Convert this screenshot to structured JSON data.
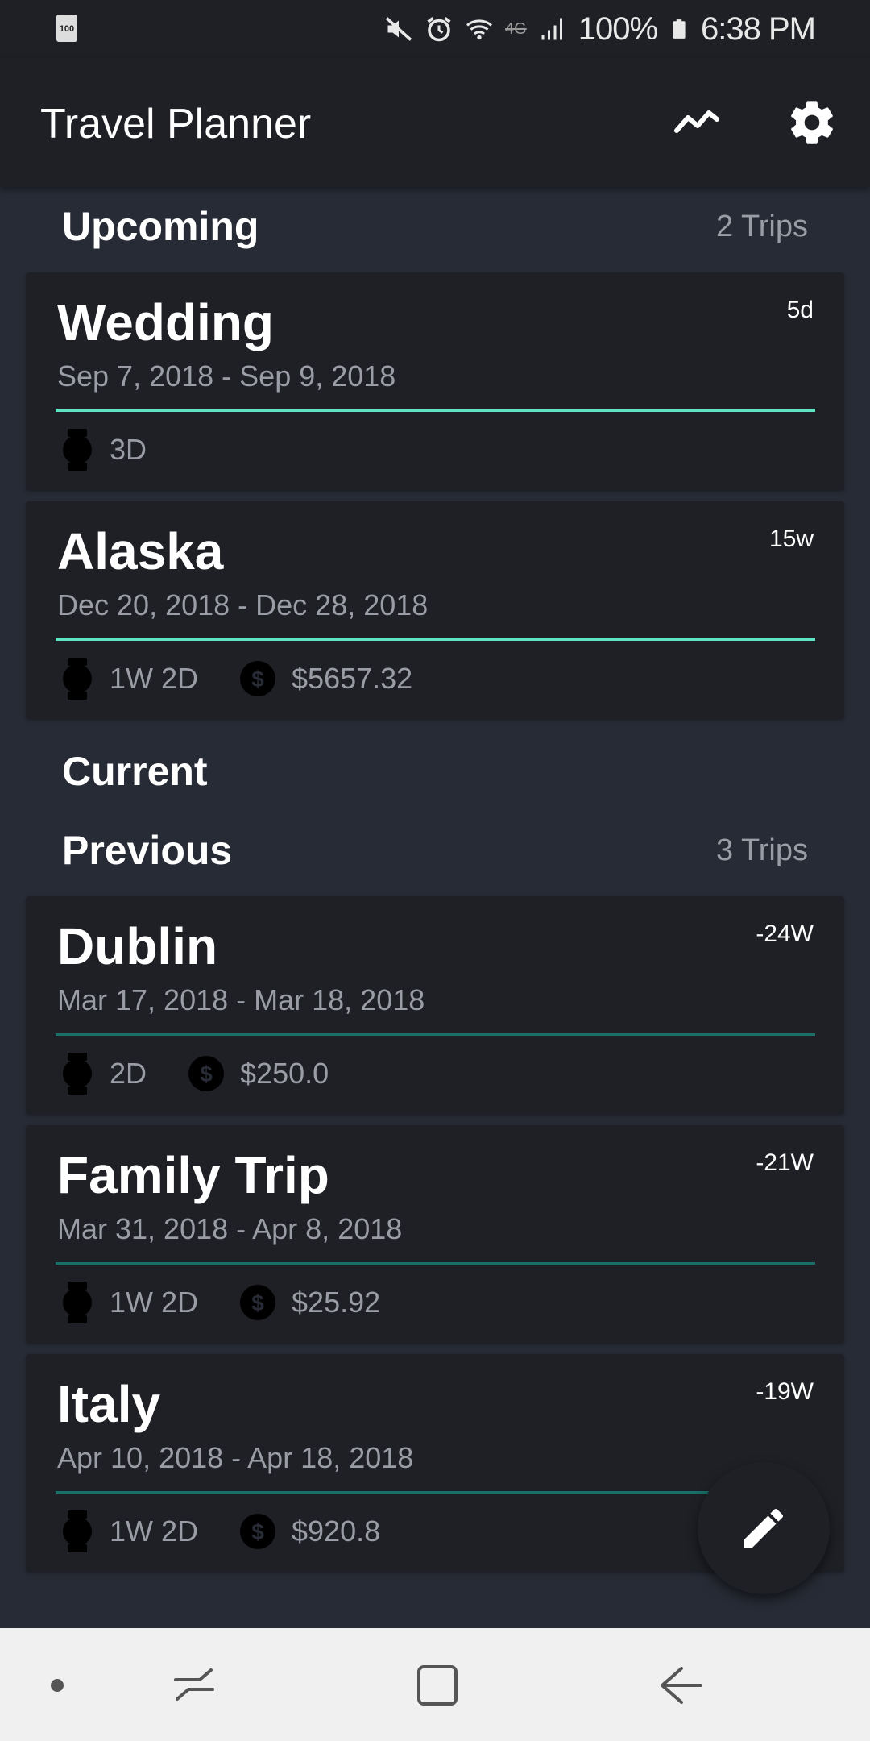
{
  "status_bar": {
    "battery_level_label": "100",
    "battery_percent": "100%",
    "time": "6:38 PM",
    "network_label": "4G",
    "icons": [
      "battery-saver-icon",
      "mute-icon",
      "alarm-icon",
      "wifi-icon",
      "lte-icon",
      "signal-icon",
      "battery-icon"
    ]
  },
  "app_bar": {
    "title": "Travel Planner",
    "icons": [
      "trend-icon",
      "gear-icon"
    ]
  },
  "sections": {
    "upcoming": {
      "title": "Upcoming",
      "count": "2 Trips"
    },
    "current": {
      "title": "Current"
    },
    "previous": {
      "title": "Previous",
      "count": "3 Trips"
    }
  },
  "trips": [
    {
      "name": "Wedding",
      "dates": "Sep 7, 2018 - Sep 9, 2018",
      "badge": "5d",
      "duration": "3D",
      "cost": ""
    },
    {
      "name": "Alaska",
      "dates": "Dec 20, 2018 - Dec 28, 2018",
      "badge": "15w",
      "duration": "1W 2D",
      "cost": "$5657.32"
    },
    {
      "name": "Dublin",
      "dates": "Mar 17, 2018 - Mar 18, 2018",
      "badge": "-24W",
      "duration": "2D",
      "cost": "$250.0"
    },
    {
      "name": "Family Trip",
      "dates": "Mar 31, 2018 - Apr 8, 2018",
      "badge": "-21W",
      "duration": "1W 2D",
      "cost": "$25.92"
    },
    {
      "name": "Italy",
      "dates": "Apr 10, 2018 - Apr 18, 2018",
      "badge": "-19W",
      "duration": "1W 2D",
      "cost": "$920.8"
    }
  ],
  "fab": {
    "icon": "pencil-icon"
  },
  "nav_bar": {
    "icons": [
      "dot-icon",
      "recents-icon",
      "home-icon",
      "back-icon"
    ]
  },
  "colors": {
    "background": "#272b35",
    "surface": "#1f2026",
    "accent_upcoming": "#5ee6c4",
    "accent_previous": "#1a6f68",
    "muted_text": "#9a9da5"
  }
}
